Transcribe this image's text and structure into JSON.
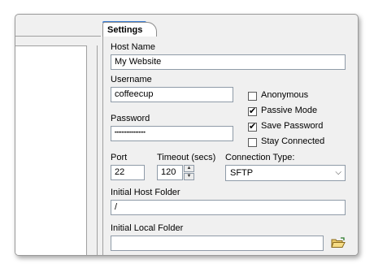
{
  "tab": {
    "label": "Settings"
  },
  "host_name": {
    "label": "Host Name",
    "value": "My Website"
  },
  "username": {
    "label": "Username",
    "value": "coffeecup"
  },
  "password": {
    "label": "Password",
    "value": "••••••••••••••••••"
  },
  "options": {
    "anonymous": {
      "label": "Anonymous",
      "checked": false
    },
    "passive_mode": {
      "label": "Passive Mode",
      "checked": true
    },
    "save_password": {
      "label": "Save Password",
      "checked": true
    },
    "stay_connected": {
      "label": "Stay Connected",
      "checked": false
    }
  },
  "port": {
    "label": "Port",
    "value": "22"
  },
  "timeout": {
    "label": "Timeout (secs)",
    "value": "120"
  },
  "connection_type": {
    "label": "Connection Type:",
    "value": "SFTP"
  },
  "initial_host_folder": {
    "label": "Initial Host Folder",
    "value": "/"
  },
  "initial_local_folder": {
    "label": "Initial Local Folder",
    "value": ""
  },
  "icons": {
    "browse_folder": "open-folder-icon",
    "check": "checkmark-icon"
  }
}
